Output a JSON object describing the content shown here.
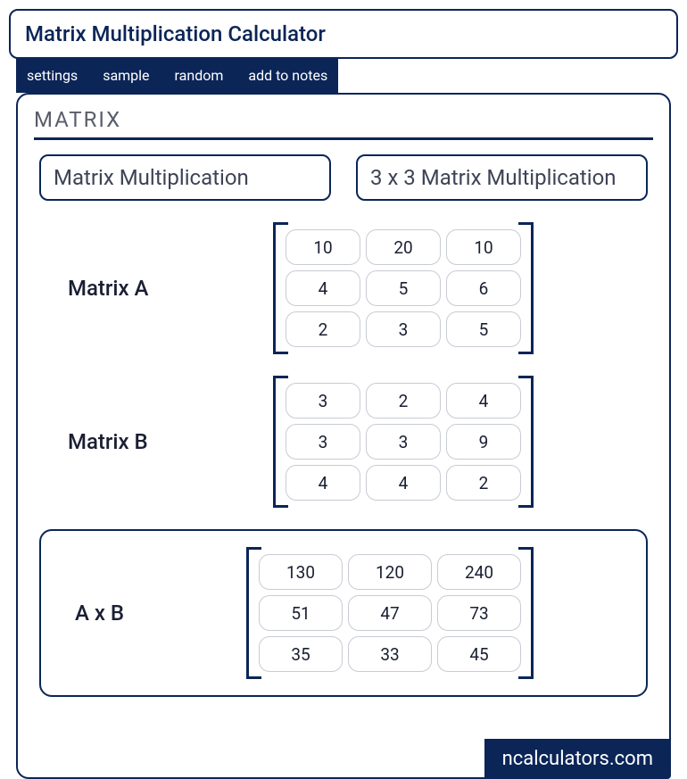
{
  "title": "Matrix Multiplication Calculator",
  "toolbar": {
    "settings": "settings",
    "sample": "sample",
    "random": "random",
    "add_to_notes": "add to notes"
  },
  "section_title": "MATRIX",
  "tabs": {
    "matrix_mult": "Matrix Multiplication",
    "x3_matrix_mult": "3 x 3 Matrix Multiplication"
  },
  "matrix_a": {
    "label": "Matrix A",
    "cells": [
      "10",
      "20",
      "10",
      "4",
      "5",
      "6",
      "2",
      "3",
      "5"
    ]
  },
  "matrix_b": {
    "label": "Matrix B",
    "cells": [
      "3",
      "2",
      "4",
      "3",
      "3",
      "9",
      "4",
      "4",
      "2"
    ]
  },
  "result": {
    "label": "A x B",
    "cells": [
      "130",
      "120",
      "240",
      "51",
      "47",
      "73",
      "35",
      "33",
      "45"
    ]
  },
  "brand": "ncalculators.com"
}
